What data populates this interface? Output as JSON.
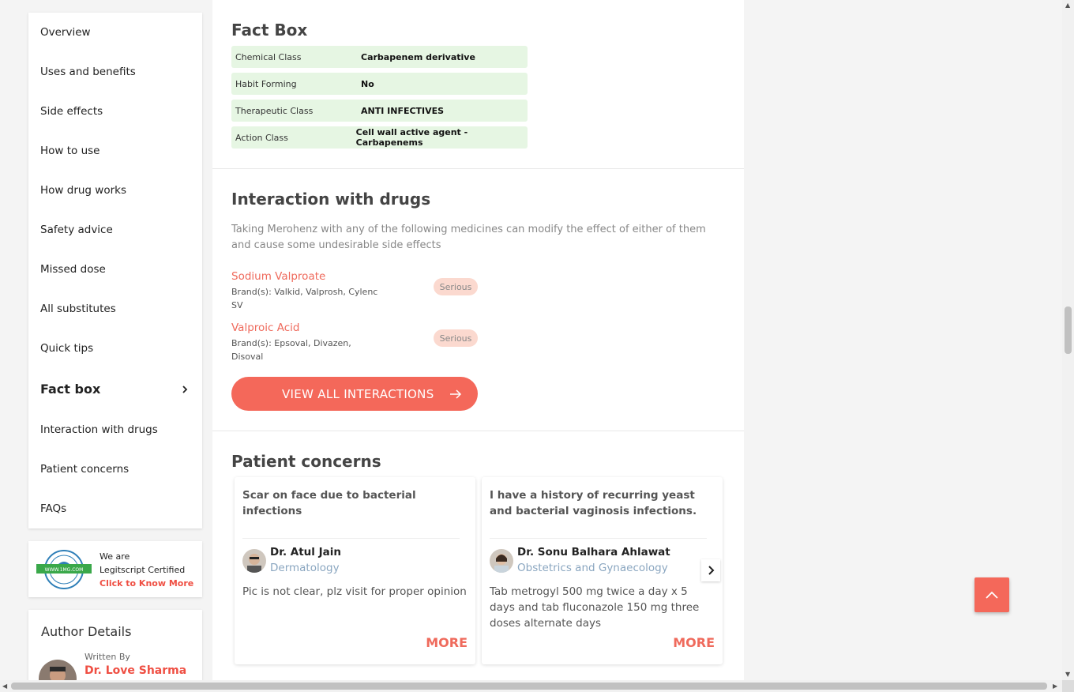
{
  "sidebar": {
    "items": [
      {
        "label": "Overview"
      },
      {
        "label": "Uses and benefits"
      },
      {
        "label": "Side effects"
      },
      {
        "label": "How to use"
      },
      {
        "label": "How drug works"
      },
      {
        "label": "Safety advice"
      },
      {
        "label": "Missed dose"
      },
      {
        "label": "All substitutes"
      },
      {
        "label": "Quick tips"
      },
      {
        "label": "Fact box"
      },
      {
        "label": "Interaction with drugs"
      },
      {
        "label": "Patient concerns"
      },
      {
        "label": "FAQs"
      }
    ],
    "active_index": 9
  },
  "legitscript": {
    "line1": "We are",
    "line2": "Legitscript Certified",
    "link": "Click to Know More",
    "badge_text": "WWW.1MG.COM"
  },
  "author": {
    "title": "Author Details",
    "written_by": "Written By",
    "name": "Dr. Love Sharma"
  },
  "fact_box": {
    "title": "Fact Box",
    "rows": [
      {
        "label": "Chemical Class",
        "value": "Carbapenem derivative"
      },
      {
        "label": "Habit Forming",
        "value": "No"
      },
      {
        "label": "Therapeutic Class",
        "value": "ANTI INFECTIVES"
      },
      {
        "label": "Action Class",
        "value": "Cell wall active agent -Carbapenems"
      }
    ]
  },
  "interactions": {
    "title": "Interaction with drugs",
    "intro": "Taking Merohenz with any of the following medicines can modify the effect of either of them and cause some undesirable side effects",
    "drugs": [
      {
        "name": "Sodium Valproate",
        "brands": "Brand(s): Valkid, Valprosh, Cylenc SV",
        "severity": "Serious"
      },
      {
        "name": "Valproic Acid",
        "brands": "Brand(s): Epsoval, Divazen, Disoval",
        "severity": "Serious"
      }
    ],
    "button": "VIEW ALL INTERACTIONS"
  },
  "patient_concerns": {
    "title": "Patient concerns",
    "cards": [
      {
        "question": "Scar on face due to bacterial infections",
        "doctor": "Dr. Atul Jain",
        "specialty": "Dermatology",
        "answer": "Pic is not clear, plz visit for proper opinion",
        "more": "MORE"
      },
      {
        "question": "I have a history of recurring yeast and bacterial vaginosis infections.",
        "doctor": "Dr. Sonu Balhara Ahlawat",
        "specialty": "Obstetrics and Gynaecology",
        "answer": "Tab metrogyl 500 mg twice a day x 5 days and tab fluconazole 150 mg three doses alternate days",
        "more": "MORE"
      }
    ]
  },
  "colors": {
    "accent": "#f4685a",
    "fact_bg": "#e6f6e3",
    "badge_bg": "#fbd9cf",
    "link": "#ef4f43"
  }
}
